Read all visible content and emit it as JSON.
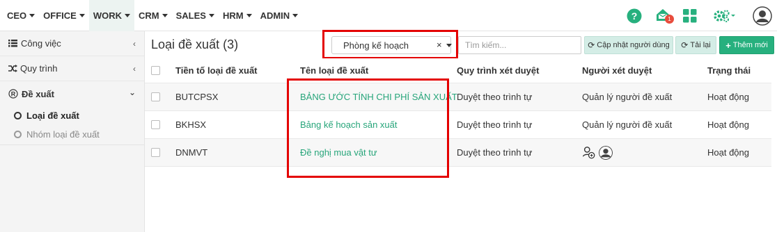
{
  "nav": {
    "items": [
      {
        "label": "CEO",
        "active": false
      },
      {
        "label": "OFFICE",
        "active": false
      },
      {
        "label": "WORK",
        "active": true
      },
      {
        "label": "CRM",
        "active": false
      },
      {
        "label": "SALES",
        "active": false
      },
      {
        "label": "HRM",
        "active": false
      },
      {
        "label": "ADMIN",
        "active": false
      }
    ],
    "notification_count": "1",
    "icons": [
      "help-icon",
      "notification-icon",
      "apps-grid-icon",
      "settings-icon",
      "user-avatar"
    ]
  },
  "sidebar": {
    "items": [
      {
        "label": "Công việc",
        "icon": "list-icon"
      },
      {
        "label": "Quy trình",
        "icon": "shuffle-icon"
      },
      {
        "label": "Đề xuất",
        "icon": "registered-icon"
      }
    ],
    "subitems": [
      {
        "label": "Loại đề xuất",
        "active": true
      },
      {
        "label": "Nhóm loại đề xuất",
        "active": false
      }
    ]
  },
  "toolbar": {
    "title": "Loại đề xuất (3)",
    "filter_value": "Phòng kế hoạch",
    "clear_label": "×",
    "search_placeholder": "Tìm kiếm...",
    "update_users_label": "Cập nhật người dùng",
    "reload_label": "Tải lại",
    "add_label": "Thêm mới"
  },
  "table": {
    "headers": [
      "Tiền tố loại đề xuất",
      "Tên loại đề xuất",
      "Quy trình xét duyệt",
      "Người xét duyệt",
      "Trạng thái"
    ],
    "rows": [
      {
        "prefix": "BUTCPSX",
        "name": "BẢNG ƯỚC TÍNH CHI PHÍ SẢN XUẤT",
        "process": "Duyệt theo trình tự",
        "approver": "Quản lý người đề xuất",
        "status": "Hoạt động"
      },
      {
        "prefix": "BKHSX",
        "name": "Bảng kế hoạch sản xuất",
        "process": "Duyệt theo trình tự",
        "approver": "Quản lý người đề xuất",
        "status": "Hoạt động"
      },
      {
        "prefix": "DNMVT",
        "name": "Đề nghị mua vật tư",
        "process": "Duyệt theo trình tự",
        "approver": "",
        "status": "Hoạt động"
      }
    ]
  },
  "colors": {
    "accent": "#27b07e",
    "link": "#27a57a",
    "highlight": "#e40000",
    "active_nav_bg": "#ecf3f1"
  }
}
